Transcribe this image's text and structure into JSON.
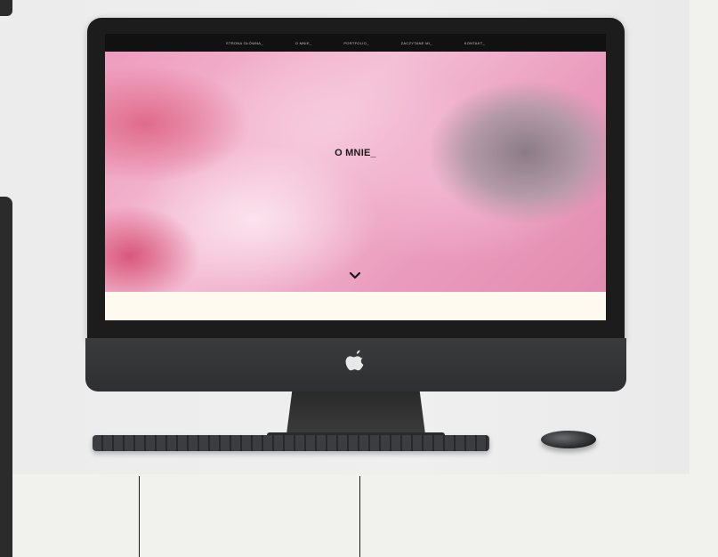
{
  "website": {
    "nav": [
      "STRONA GŁÓWNA_",
      "O MNIE_",
      "PORTFOLIO_",
      "ZACZYTANE MI_",
      "KONTAKT_"
    ],
    "hero_title": "O MNIE_",
    "scroll_icon": "chevron-down-icon"
  },
  "device": {
    "brand_icon": "apple-logo-icon"
  },
  "colors": {
    "page_background": "#f1f1ee",
    "bezel": "#1c1c1d",
    "hero_pink": "#ee9cbd",
    "cream_band": "#fffaf0"
  }
}
